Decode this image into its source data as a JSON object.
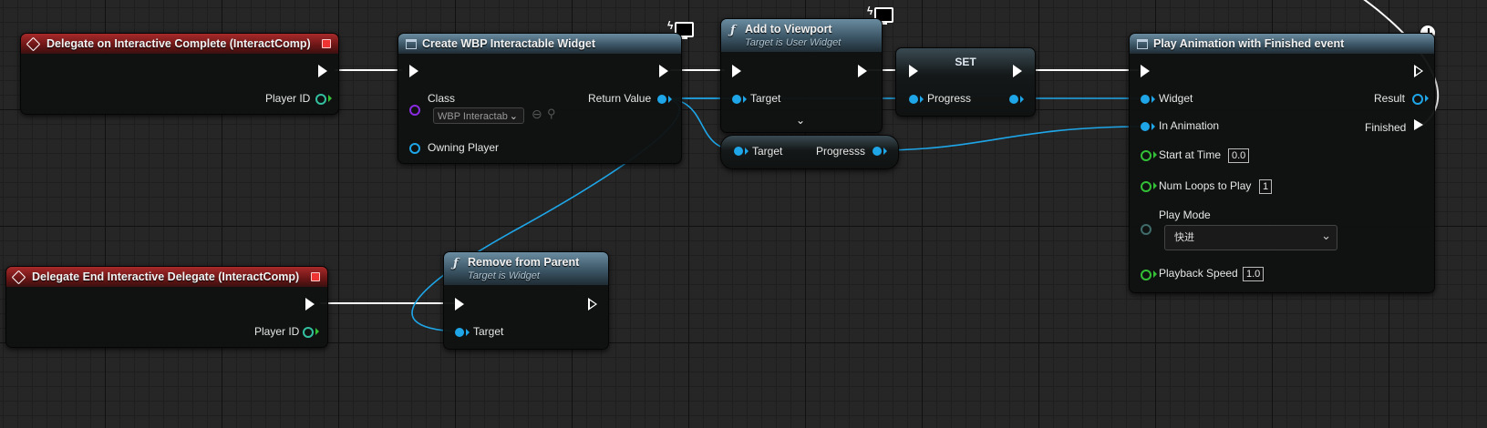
{
  "nodes": {
    "delegate_complete": {
      "title": "Delegate on Interactive Complete (InteractComp)",
      "player_id_label": "Player ID"
    },
    "delegate_end": {
      "title": "Delegate End Interactive Delegate (InteractComp)",
      "player_id_label": "Player ID"
    },
    "create_widget": {
      "title": "Create WBP Interactable Widget",
      "class_label": "Class",
      "class_value": "WBP Interactab",
      "return_value_label": "Return Value",
      "owning_player_label": "Owning Player"
    },
    "add_to_viewport": {
      "title": "Add to Viewport",
      "subtitle": "Target is User Widget",
      "target_label": "Target"
    },
    "set_node": {
      "title": "SET",
      "progress_label": "Progress"
    },
    "get_progress": {
      "target_label": "Target",
      "progress_label": "Progresss"
    },
    "remove_from_parent": {
      "title": "Remove from Parent",
      "subtitle": "Target is Widget",
      "target_label": "Target"
    },
    "play_animation": {
      "title": "Play Animation with Finished event",
      "widget_label": "Widget",
      "in_animation_label": "In Animation",
      "start_at_time_label": "Start at Time",
      "start_at_time_value": "0.0",
      "num_loops_label": "Num Loops to Play",
      "num_loops_value": "1",
      "play_mode_label": "Play Mode",
      "play_mode_value": "快进",
      "playback_speed_label": "Playback Speed",
      "playback_speed_value": "1.0",
      "result_label": "Result",
      "finished_label": "Finished"
    }
  },
  "colors": {
    "exec_wire": "#ffffff",
    "object_pin": "#1ea6e8",
    "float_pin": "#33c036",
    "class_pin": "#8a2be2",
    "event_header": "#8b1e1e",
    "function_header": "#4a6a7e"
  },
  "icons": [
    "diamond-event-icon",
    "function-icon",
    "monitor-icon",
    "clock-icon",
    "chevron-down-icon",
    "browse-icon",
    "search-icon"
  ]
}
